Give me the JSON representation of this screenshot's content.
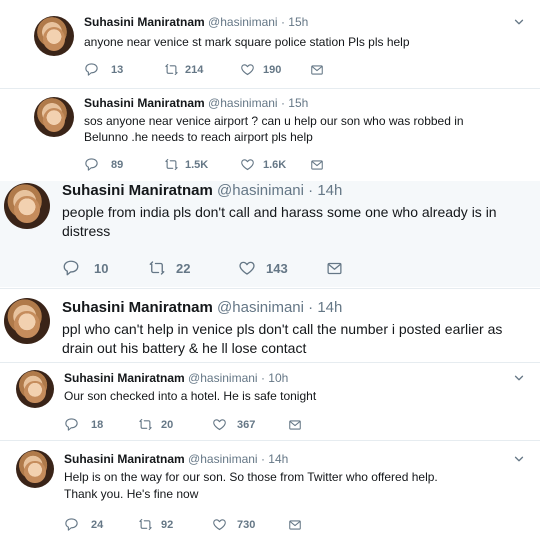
{
  "tweets": [
    {
      "name": "Suhasini Maniratnam",
      "handle": "@hasinimani",
      "time": "15h",
      "text": "anyone near venice st mark square police station Pls pls help",
      "replies": "13",
      "retweets": "214",
      "likes": "190"
    },
    {
      "name": "Suhasini Maniratnam",
      "handle": "@hasinimani",
      "time": "15h",
      "text": "sos  anyone near venice airport ? can u help our son who was robbed in Belunno .he needs to reach airport   pls help",
      "replies": "89",
      "retweets": "1.5K",
      "likes": "1.6K"
    },
    {
      "name": "Suhasini Maniratnam",
      "handle": "@hasinimani",
      "time": "14h",
      "text": "people from india pls don't call and harass some one who  already is in distress",
      "replies": "10",
      "retweets": "22",
      "likes": "143"
    },
    {
      "name": "Suhasini Maniratnam",
      "handle": "@hasinimani",
      "time": "14h",
      "text": "ppl who can't help in venice pls don't call the number i posted earlier as drain out his battery & he ll lose contact"
    },
    {
      "name": "Suhasini Maniratnam",
      "handle": "@hasinimani",
      "time": "10h",
      "text": "Our son checked into a hotel.  He is safe tonight",
      "replies": "18",
      "retweets": "20",
      "likes": "367"
    },
    {
      "name": "Suhasini Maniratnam",
      "handle": "@hasinimani",
      "time": "14h",
      "text_lines": [
        "Help is on the way for our son. So those from Twitter who offered help.",
        "Thank you. He's fine now"
      ],
      "replies": "24",
      "retweets": "92",
      "likes": "730"
    }
  ],
  "separator": "·",
  "icons": {
    "reply": "reply-icon",
    "retweet": "retweet-icon",
    "like": "heart-icon",
    "message": "envelope-icon",
    "more": "chevron-down-icon"
  },
  "colors": {
    "text": "#14171a",
    "muted": "#657786",
    "divider": "#e6ecf0"
  }
}
